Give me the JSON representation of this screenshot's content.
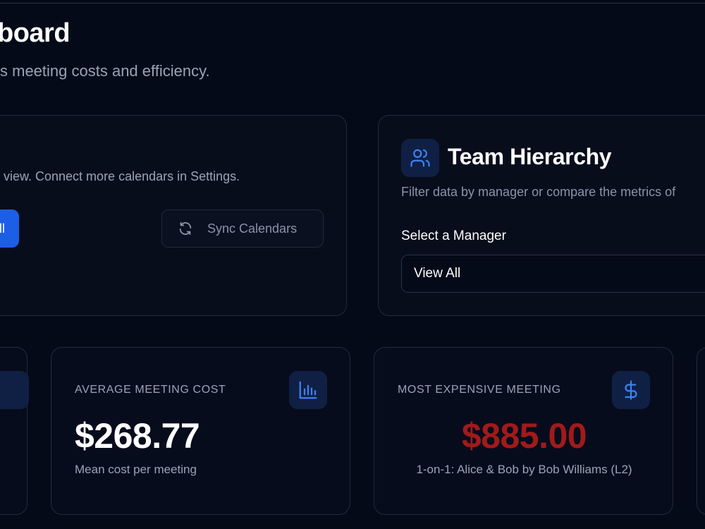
{
  "header": {
    "title": "board",
    "subtitle": "s meeting costs and efficiency."
  },
  "calendar_panel": {
    "description": "view. Connect more calendars in Settings.",
    "primary_button_label": "ll",
    "sync_button_label": "Sync Calendars"
  },
  "team_panel": {
    "title": "Team Hierarchy",
    "description": "Filter data by manager or compare the metrics of",
    "select_label": "Select a Manager",
    "select_value": "View All"
  },
  "cards": {
    "average": {
      "label": "AVERAGE MEETING COST",
      "value": "$268.77",
      "caption": "Mean cost per meeting"
    },
    "expensive": {
      "label": "MOST EXPENSIVE MEETING",
      "value": "$885.00",
      "caption": "1-on-1: Alice & Bob by Bob Williams (L2)"
    }
  },
  "colors": {
    "background": "#050a18",
    "accent": "#1d5ee6",
    "icon": "#3b82f6",
    "danger": "#a11a1a"
  },
  "icons": {
    "sync": "refresh-icon",
    "team": "users-icon",
    "average": "bar-chart-icon",
    "expensive": "dollar-icon"
  }
}
